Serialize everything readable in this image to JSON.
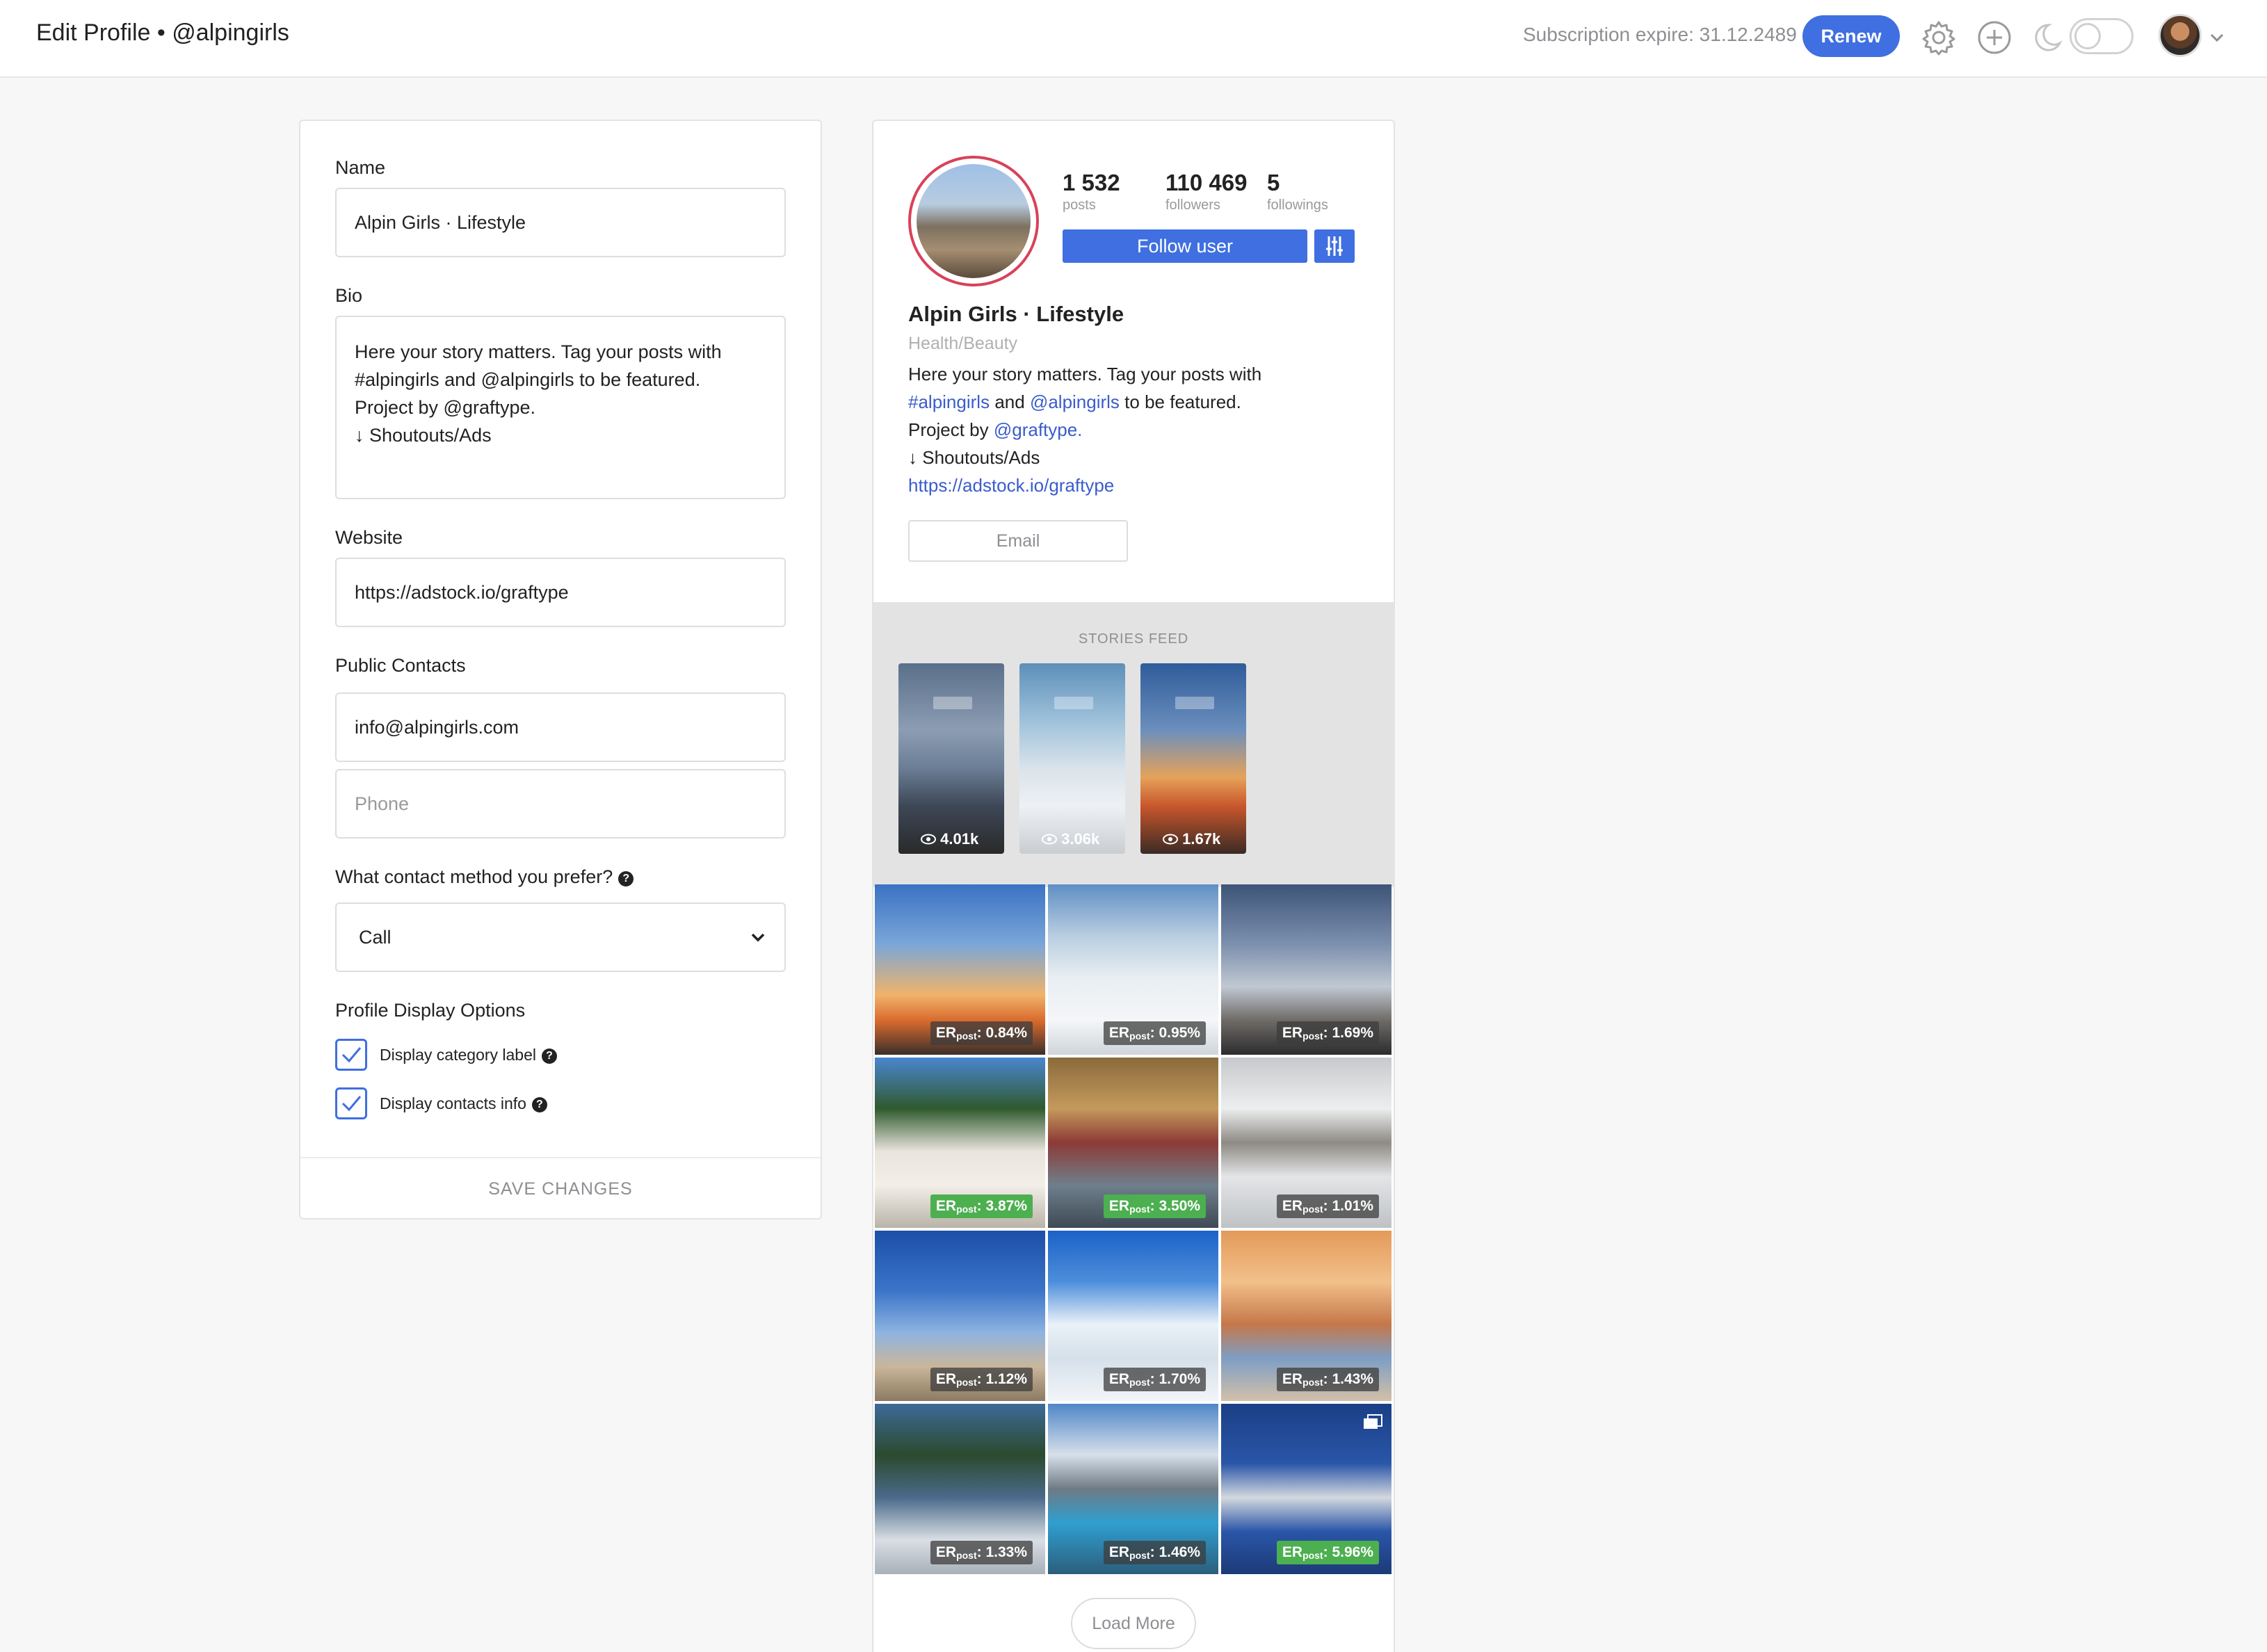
{
  "header": {
    "title": "Edit Profile • @alpingirls",
    "subscription_text": "Subscription expire: 31.12.2489",
    "renew_label": "Renew",
    "icons": [
      "gear-icon",
      "plus-circle-icon",
      "moon-icon",
      "avatar",
      "chevron-down-icon"
    ],
    "accent_color": "#3f6fe0"
  },
  "form": {
    "name_label": "Name",
    "name_value": "Alpin Girls · Lifestyle",
    "bio_label": "Bio",
    "bio_lines": [
      "Here your story matters. Tag your posts with",
      "#alpingirls and @alpingirls to be featured.",
      "Project by @graftype.",
      "↓ Shoutouts/Ads"
    ],
    "website_label": "Website",
    "website_value": "https://adstock.io/graftype",
    "contacts_label": "Public Contacts",
    "email_value": "info@alpingirls.com",
    "phone_placeholder": "Phone",
    "contact_method_label": "What contact method you prefer?",
    "contact_method_value": "Call",
    "display_options_label": "Profile Display Options",
    "checkbox_category": "Display category label",
    "checkbox_contacts": "Display contacts info",
    "save_label": "SAVE CHANGES"
  },
  "profile": {
    "posts_count": "1 532",
    "posts_label": "posts",
    "followers_count": "110 469",
    "followers_label": "followers",
    "followings_count": "5",
    "followings_label": "followings",
    "follow_label": "Follow user",
    "name": "Alpin Girls · Lifestyle",
    "category": "Health/Beauty",
    "bio_line1": "Here your story matters. Tag your posts with",
    "bio_line2_tag": "#alpingirls",
    "bio_line2_and": "and",
    "bio_line2_mention": "@alpingirls",
    "bio_line2_rest": "to be featured.",
    "bio_line3_prefix": "Project by",
    "bio_line3_mention": "@graftype.",
    "bio_line4": "↓ Shoutouts/Ads",
    "website": "https://adstock.io/graftype",
    "email_label": "Email"
  },
  "stories": {
    "label": "STORIES FEED",
    "items": [
      {
        "views": "4.01k"
      },
      {
        "views": "3.06k"
      },
      {
        "views": "1.67k"
      }
    ]
  },
  "posts": {
    "er_prefix": "ER",
    "er_sub": "post",
    "items": [
      {
        "er": "0.84%",
        "highlight": false
      },
      {
        "er": "0.95%",
        "highlight": false
      },
      {
        "er": "1.69%",
        "highlight": false
      },
      {
        "er": "3.87%",
        "highlight": true
      },
      {
        "er": "3.50%",
        "highlight": true
      },
      {
        "er": "1.01%",
        "highlight": false
      },
      {
        "er": "1.12%",
        "highlight": false
      },
      {
        "er": "1.70%",
        "highlight": false
      },
      {
        "er": "1.43%",
        "highlight": false
      },
      {
        "er": "1.33%",
        "highlight": false
      },
      {
        "er": "1.46%",
        "highlight": false
      },
      {
        "er": "5.96%",
        "highlight": true
      }
    ]
  },
  "load_more_label": "Load More"
}
